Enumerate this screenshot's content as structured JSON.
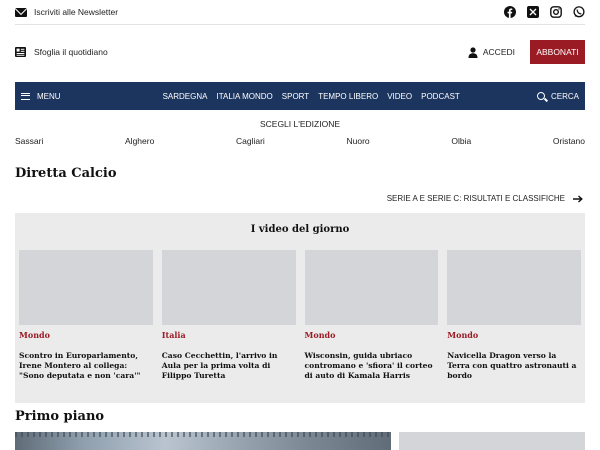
{
  "topbar": {
    "newsletter_label": "Iscriviti alle Newsletter",
    "social_icons": [
      "facebook-icon",
      "x-icon",
      "instagram-icon",
      "whatsapp-icon"
    ]
  },
  "secbar": {
    "quotidiano_label": "Sfoglia il quotidiano",
    "accedi_label": "ACCEDI",
    "abbonati_label": "ABBONATI"
  },
  "nav": {
    "menu_label": "MENU",
    "links": [
      "SARDEGNA",
      "ITALIA MONDO",
      "SPORT",
      "TEMPO LIBERO",
      "VIDEO",
      "PODCAST"
    ],
    "search_label": "CERCA"
  },
  "editions": {
    "label": "SCEGLI L'EDIZIONE",
    "items": [
      "Sassari",
      "Alghero",
      "Cagliari",
      "Nuoro",
      "Olbia",
      "Oristano"
    ]
  },
  "calcio": {
    "title": "Diretta Calcio",
    "link_label": "SERIE A E SERIE C: RISULTATI E CLASSIFICHE"
  },
  "videos": {
    "title": "I video del giorno",
    "items": [
      {
        "category": "Mondo",
        "title": "Scontro in Europarlamento, Irene Montero al collega: \"Sono deputata e non 'cara'\""
      },
      {
        "category": "Italia",
        "title": "Caso Cecchettin, l'arrivo in Aula per la prima volta di Filippo Turetta"
      },
      {
        "category": "Mondo",
        "title": "Wisconsin, guida ubriaco contromano e 'sfiora' il corteo di auto di Kamala Harris"
      },
      {
        "category": "Mondo",
        "title": "Navicella Dragon verso la Terra con quattro astronauti a bordo"
      }
    ]
  },
  "primo_piano": {
    "title": "Primo piano"
  },
  "colors": {
    "navy": "#1c355e",
    "accent_red": "#9a1b24",
    "panel_gray": "#ebebeb"
  }
}
